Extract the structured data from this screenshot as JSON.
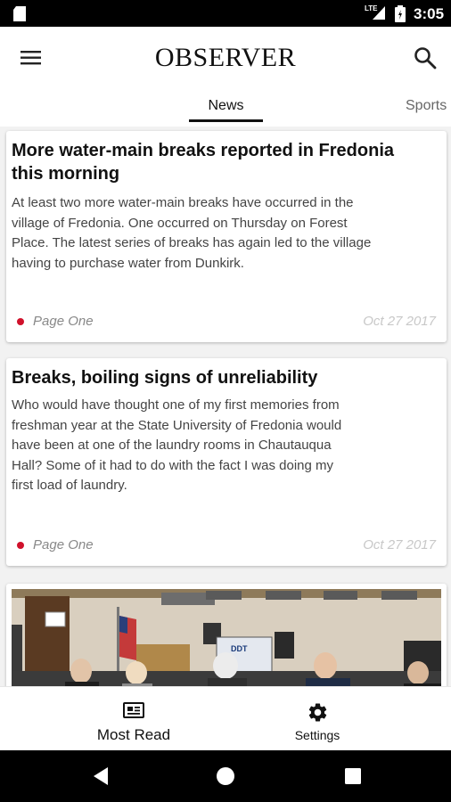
{
  "status_bar": {
    "time": "3:05",
    "network": "LTE",
    "icons": [
      "sd-card-icon",
      "signal-icon",
      "battery-icon"
    ]
  },
  "app_bar": {
    "title": "OBSERVER",
    "icons": [
      "menu-icon",
      "search-icon"
    ]
  },
  "tabs": [
    {
      "label": "News",
      "selected": true
    },
    {
      "label": "Sports",
      "selected": false
    }
  ],
  "articles": [
    {
      "title": "More water-main breaks reported in Fredonia this morning",
      "summary_lines": [
        "At least two more water-main breaks have occurred in the",
        "village of Fredonia. One occurred on Thursday on Forest",
        "Place. The latest series of breaks has again led to the village",
        "having to purchase water from Dunkirk."
      ],
      "section": "Page One",
      "date": "Oct 27 2017"
    },
    {
      "title": "Breaks, boiling signs of unreliability",
      "summary_lines": [
        "Who would have thought one of my first memories from",
        "freshman year at the State University of Fredonia would",
        "have been at one of the laundry rooms in Chautauqua",
        "Hall? Some of it had to do with the fact I was doing my",
        "first load of laundry."
      ],
      "section": "Page One",
      "date": "Oct 27 2017"
    },
    {
      "image": "meeting-photo"
    }
  ],
  "bottom_nav": [
    {
      "label": "Most Read",
      "icon": "newspaper-icon"
    },
    {
      "label": "Settings",
      "icon": "gear-icon"
    }
  ],
  "system_nav": [
    "back-icon",
    "home-icon",
    "recents-icon"
  ],
  "colors": {
    "accent_dot": "#d0112b",
    "text_primary": "#111111",
    "background": "#f2f2f2"
  }
}
